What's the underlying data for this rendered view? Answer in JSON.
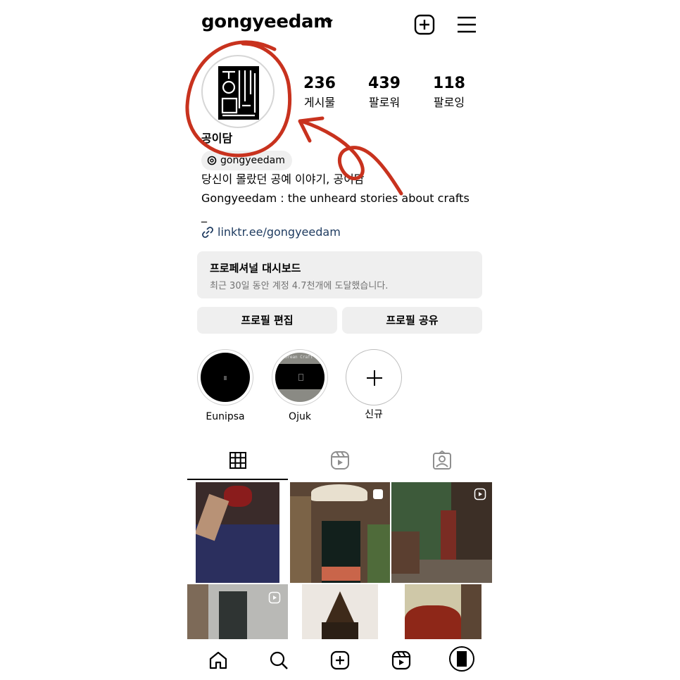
{
  "header": {
    "username": "gongyeedam"
  },
  "profile": {
    "stats": [
      {
        "value": "236",
        "label": "게시물"
      },
      {
        "value": "439",
        "label": "팔로워"
      },
      {
        "value": "118",
        "label": "팔로잉"
      }
    ],
    "name": "공이담",
    "threads_handle": "gongyeedam",
    "bio_line1": "당신이 몰랐던 공예 이야기, 공이담",
    "bio_line2": "Gongyeedam : the unheard stories about crafts",
    "bio_line3": "_",
    "link": "linktr.ee/gongyeedam"
  },
  "dashboard": {
    "title": "프로페셔널 대시보드",
    "subtitle": "최근 30일 동안 계정 4.7천개에 도달했습니다."
  },
  "buttons": {
    "edit_profile": "프로필 편집",
    "share_profile": "프로필 공유"
  },
  "highlights": [
    {
      "label": "Eunipsa"
    },
    {
      "label": "Ojuk",
      "cover_text": "Korean Craft"
    },
    {
      "label": "신규"
    }
  ],
  "tabs": [
    "grid-icon",
    "reels-icon",
    "tagged-icon"
  ],
  "nav": [
    "home-icon",
    "search-icon",
    "create-icon",
    "reels-icon",
    "profile-icon"
  ],
  "colors": {
    "annotation_red": "#c8321e",
    "link_blue": "#1d3a5f",
    "button_bg": "#efefef"
  }
}
